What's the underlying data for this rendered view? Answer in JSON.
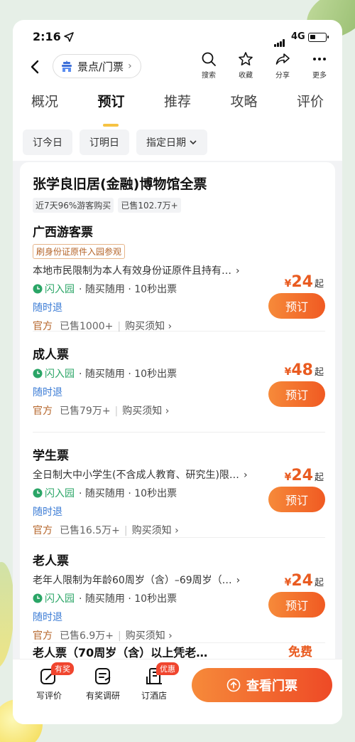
{
  "status": {
    "time": "2:16",
    "network": "4G"
  },
  "nav": {
    "scenic_label": "景点/门票",
    "actions": [
      {
        "label": "搜索",
        "icon": "search-icon"
      },
      {
        "label": "收藏",
        "icon": "star-icon"
      },
      {
        "label": "分享",
        "icon": "share-icon"
      },
      {
        "label": "更多",
        "icon": "more-icon"
      }
    ]
  },
  "tabs": [
    "概况",
    "预订",
    "推荐",
    "攻略",
    "评价"
  ],
  "active_tab": "预订",
  "filters": [
    "订今日",
    "订明日",
    "指定日期"
  ],
  "product": {
    "title": "张学良旧居(金融)博物馆全票",
    "badges": [
      "近7天96%游客购买",
      "已售102.7万+"
    ]
  },
  "tickets": [
    {
      "name": "广西游客票",
      "tag": "刷身份证原件入园参观",
      "desc": "本地市民限制为本人有效身份证原件且持有…",
      "flash": "闪入园",
      "features": "· 随买随用 · 10秒出票",
      "refund": "随时退",
      "official": "官方",
      "sold": "已售1000+",
      "notice": "购买须知",
      "price": "24",
      "price_suffix": "起",
      "book": "预订"
    },
    {
      "name": "成人票",
      "flash": "闪入园",
      "features": "· 随买随用 · 10秒出票",
      "refund": "随时退",
      "official": "官方",
      "sold": "已售79万+",
      "notice": "购买须知",
      "price": "48",
      "price_suffix": "起",
      "book": "预订"
    },
    {
      "name": "学生票",
      "desc": "全日制大中小学生(不含成人教育、研究生)限…",
      "flash": "闪入园",
      "features": "· 随买随用 · 10秒出票",
      "refund": "随时退",
      "official": "官方",
      "sold": "已售16.5万+",
      "notice": "购买须知",
      "price": "24",
      "price_suffix": "起",
      "book": "预订"
    },
    {
      "name": "老人票",
      "desc": "老年人限制为年龄60周岁（含）–69周岁（…",
      "flash": "闪入园",
      "features": "· 随买随用 · 10秒出票",
      "refund": "随时退",
      "official": "官方",
      "sold": "已售6.9万+",
      "notice": "购买须知",
      "price": "24",
      "price_suffix": "起",
      "book": "预订"
    }
  ],
  "partial_ticket": {
    "name": "老人票（70周岁（含）以上凭老…",
    "price": "免费"
  },
  "currency": "¥",
  "bottom": {
    "items": [
      {
        "label": "写评价",
        "badge": "有奖"
      },
      {
        "label": "有奖调研"
      },
      {
        "label": "订酒店",
        "badge": "优惠"
      }
    ],
    "cta": "查看门票"
  },
  "colors": {
    "accent": "#f05a22",
    "flash": "#2aa566",
    "refund": "#3a7bd5",
    "tab_indicator": "#f6c343"
  }
}
